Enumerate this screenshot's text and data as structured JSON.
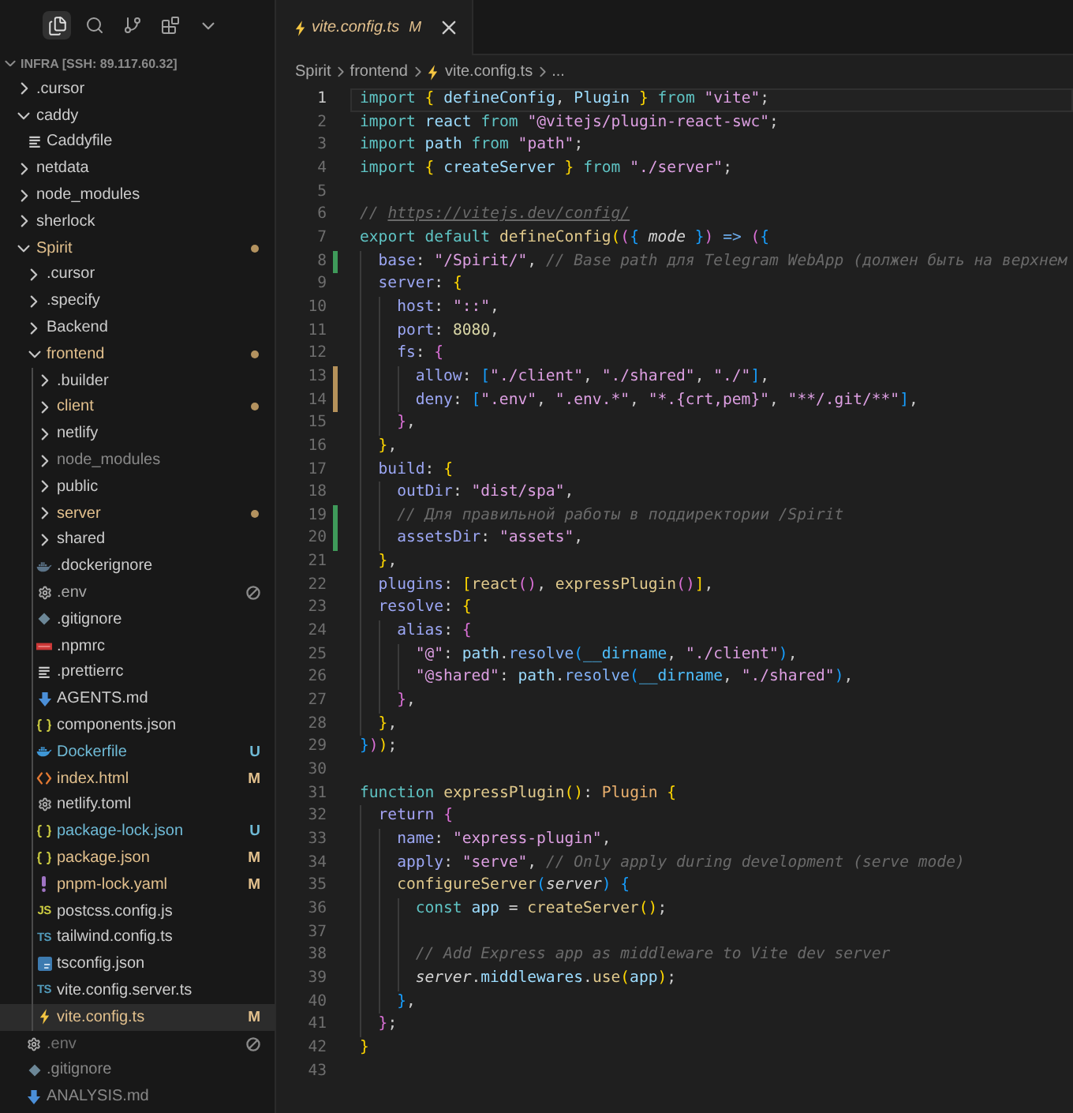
{
  "sidebar": {
    "toolbar": [
      {
        "kind": "explorer",
        "selected": true
      },
      {
        "kind": "search",
        "selected": false
      },
      {
        "kind": "source-control",
        "selected": false
      },
      {
        "kind": "extensions",
        "selected": false
      },
      {
        "kind": "more",
        "selected": false
      }
    ],
    "root": {
      "label": "INFRA [SSH: 89.117.60.32]",
      "expanded": true
    },
    "items": [
      {
        "name": ".cursor",
        "kind": "folder",
        "expanded": false,
        "selected": false,
        "modified": false,
        "untracked": false,
        "ignored": false,
        "excluded": false
      },
      {
        "name": "caddy",
        "kind": "folder",
        "expanded": true,
        "selected": false,
        "modified": false,
        "untracked": false,
        "ignored": false,
        "excluded": false,
        "children": [
          {
            "name": "Caddyfile",
            "kind": "text",
            "selected": false,
            "modified": false,
            "untracked": false,
            "ignored": false,
            "excluded": false
          }
        ]
      },
      {
        "name": "netdata",
        "kind": "folder",
        "expanded": false,
        "selected": false,
        "modified": false,
        "untracked": false,
        "ignored": false,
        "excluded": false
      },
      {
        "name": "node_modules",
        "kind": "folder",
        "expanded": false,
        "selected": false,
        "modified": false,
        "untracked": false,
        "ignored": false,
        "excluded": false
      },
      {
        "name": "sherlock",
        "kind": "folder",
        "expanded": false,
        "selected": false,
        "modified": false,
        "untracked": false,
        "ignored": false,
        "excluded": false
      },
      {
        "name": "Spirit",
        "kind": "folder",
        "expanded": true,
        "selected": false,
        "modified": true,
        "untracked": false,
        "ignored": false,
        "excluded": false,
        "children": [
          {
            "name": ".cursor",
            "kind": "folder",
            "expanded": false,
            "selected": false,
            "modified": false,
            "untracked": false,
            "ignored": false,
            "excluded": false
          },
          {
            "name": ".specify",
            "kind": "folder",
            "expanded": false,
            "selected": false,
            "modified": false,
            "untracked": false,
            "ignored": false,
            "excluded": false
          },
          {
            "name": "Backend",
            "kind": "folder",
            "expanded": false,
            "selected": false,
            "modified": false,
            "untracked": false,
            "ignored": false,
            "excluded": false
          },
          {
            "name": "frontend",
            "kind": "folder",
            "expanded": true,
            "selected": false,
            "modified": true,
            "untracked": false,
            "ignored": false,
            "excluded": false,
            "children": [
              {
                "name": ".builder",
                "kind": "folder",
                "expanded": false,
                "selected": false,
                "modified": false,
                "untracked": false,
                "ignored": false,
                "excluded": false
              },
              {
                "name": "client",
                "kind": "folder",
                "expanded": false,
                "selected": false,
                "modified": true,
                "untracked": false,
                "ignored": false,
                "excluded": false
              },
              {
                "name": "netlify",
                "kind": "folder",
                "expanded": false,
                "selected": false,
                "modified": false,
                "untracked": false,
                "ignored": false,
                "excluded": false
              },
              {
                "name": "node_modules",
                "kind": "folder",
                "expanded": false,
                "selected": false,
                "modified": false,
                "untracked": false,
                "ignored": true,
                "excluded": false
              },
              {
                "name": "public",
                "kind": "folder",
                "expanded": false,
                "selected": false,
                "modified": false,
                "untracked": false,
                "ignored": false,
                "excluded": false
              },
              {
                "name": "server",
                "kind": "folder",
                "expanded": false,
                "selected": false,
                "modified": true,
                "untracked": false,
                "ignored": false,
                "excluded": false
              },
              {
                "name": "shared",
                "kind": "folder",
                "expanded": false,
                "selected": false,
                "modified": false,
                "untracked": false,
                "ignored": false,
                "excluded": false
              },
              {
                "name": ".dockerignore",
                "kind": "dockerignore",
                "selected": false,
                "modified": false,
                "untracked": false,
                "ignored": false,
                "excluded": false
              },
              {
                "name": ".env",
                "kind": "settings",
                "selected": false,
                "modified": false,
                "untracked": false,
                "ignored": false,
                "excluded": true
              },
              {
                "name": ".gitignore",
                "kind": "git",
                "selected": false,
                "modified": false,
                "untracked": false,
                "ignored": false,
                "excluded": false
              },
              {
                "name": ".npmrc",
                "kind": "npm",
                "selected": false,
                "modified": false,
                "untracked": false,
                "ignored": false,
                "excluded": false
              },
              {
                "name": ".prettierrc",
                "kind": "text",
                "selected": false,
                "modified": false,
                "untracked": false,
                "ignored": false,
                "excluded": false
              },
              {
                "name": "AGENTS.md",
                "kind": "markdown",
                "selected": false,
                "modified": false,
                "untracked": false,
                "ignored": false,
                "excluded": false
              },
              {
                "name": "components.json",
                "kind": "json",
                "selected": false,
                "modified": false,
                "untracked": false,
                "ignored": false,
                "excluded": false
              },
              {
                "name": "Dockerfile",
                "kind": "docker",
                "selected": false,
                "modified": false,
                "untracked": true,
                "ignored": false,
                "excluded": false,
                "badge": "U"
              },
              {
                "name": "index.html",
                "kind": "html",
                "selected": false,
                "modified": true,
                "untracked": false,
                "ignored": false,
                "excluded": false,
                "badge": "M"
              },
              {
                "name": "netlify.toml",
                "kind": "settings",
                "selected": false,
                "modified": false,
                "untracked": false,
                "ignored": false,
                "excluded": false
              },
              {
                "name": "package-lock.json",
                "kind": "json",
                "selected": false,
                "modified": false,
                "untracked": true,
                "ignored": false,
                "excluded": false,
                "badge": "U"
              },
              {
                "name": "package.json",
                "kind": "json",
                "selected": false,
                "modified": true,
                "untracked": false,
                "ignored": false,
                "excluded": false,
                "badge": "M"
              },
              {
                "name": "pnpm-lock.yaml",
                "kind": "yaml",
                "selected": false,
                "modified": true,
                "untracked": false,
                "ignored": false,
                "excluded": false,
                "badge": "M"
              },
              {
                "name": "postcss.config.js",
                "kind": "js",
                "icon_label": "JS",
                "selected": false,
                "modified": false,
                "untracked": false,
                "ignored": false,
                "excluded": false
              },
              {
                "name": "tailwind.config.ts",
                "kind": "ts",
                "icon_label": "TS",
                "selected": false,
                "modified": false,
                "untracked": false,
                "ignored": false,
                "excluded": false
              },
              {
                "name": "tsconfig.json",
                "kind": "tsconfig",
                "selected": false,
                "modified": false,
                "untracked": false,
                "ignored": false,
                "excluded": false
              },
              {
                "name": "vite.config.server.ts",
                "kind": "ts",
                "icon_label": "TS",
                "selected": false,
                "modified": false,
                "untracked": false,
                "ignored": false,
                "excluded": false
              },
              {
                "name": "vite.config.ts",
                "kind": "vite",
                "selected": true,
                "modified": true,
                "untracked": false,
                "ignored": false,
                "excluded": false,
                "badge": "M"
              }
            ]
          },
          {
            "name": ".env",
            "kind": "settings",
            "selected": false,
            "modified": false,
            "untracked": false,
            "ignored": true,
            "excluded": true
          },
          {
            "name": ".gitignore",
            "kind": "git",
            "selected": false,
            "modified": false,
            "untracked": false,
            "ignored": true,
            "excluded": false
          },
          {
            "name": "ANALYSIS.md",
            "kind": "markdown",
            "selected": false,
            "modified": false,
            "untracked": false,
            "ignored": true,
            "excluded": false
          }
        ]
      }
    ]
  },
  "editor": {
    "tabs": [
      {
        "label": "vite.config.ts",
        "kind": "vite",
        "badge": "M",
        "modified": true,
        "preview": true,
        "selected": true
      }
    ],
    "breadcrumbs": [
      {
        "label": "Spirit",
        "kind": "folder"
      },
      {
        "label": "frontend",
        "kind": "folder"
      },
      {
        "label": "vite.config.ts",
        "kind": "vite"
      },
      {
        "label": "...",
        "kind": "more"
      }
    ],
    "lines": [
      {
        "number": "1",
        "current": true,
        "tokens": [
          {
            "kind": "keyword",
            "text": "import "
          },
          {
            "kind": "bracket1",
            "text": "{ "
          },
          {
            "kind": "variable",
            "text": "defineConfig"
          },
          {
            "kind": "punct",
            "text": ", "
          },
          {
            "kind": "variable",
            "text": "Plugin "
          },
          {
            "kind": "bracket1",
            "text": "} "
          },
          {
            "kind": "keyword",
            "text": "from "
          },
          {
            "kind": "string",
            "text": "\"vite\""
          },
          {
            "kind": "punct",
            "text": ";"
          }
        ]
      },
      {
        "number": "2",
        "current": false,
        "tokens": [
          {
            "kind": "keyword",
            "text": "import "
          },
          {
            "kind": "variable",
            "text": "react "
          },
          {
            "kind": "keyword",
            "text": "from "
          },
          {
            "kind": "string",
            "text": "\"@vitejs/plugin-react-swc\""
          },
          {
            "kind": "punct",
            "text": ";"
          }
        ]
      },
      {
        "number": "3",
        "current": false,
        "tokens": [
          {
            "kind": "keyword",
            "text": "import "
          },
          {
            "kind": "variable",
            "text": "path "
          },
          {
            "kind": "keyword",
            "text": "from "
          },
          {
            "kind": "string",
            "text": "\"path\""
          },
          {
            "kind": "punct",
            "text": ";"
          }
        ]
      },
      {
        "number": "4",
        "current": false,
        "tokens": [
          {
            "kind": "keyword",
            "text": "import "
          },
          {
            "kind": "bracket1",
            "text": "{ "
          },
          {
            "kind": "variable",
            "text": "createServer "
          },
          {
            "kind": "bracket1",
            "text": "} "
          },
          {
            "kind": "keyword",
            "text": "from "
          },
          {
            "kind": "string",
            "text": "\"./server\""
          },
          {
            "kind": "punct",
            "text": ";"
          }
        ]
      },
      {
        "number": "5",
        "current": false
      },
      {
        "number": "6",
        "current": false,
        "tokens": [
          {
            "kind": "comment",
            "text": "// "
          },
          {
            "kind": "link",
            "text": "https://vitejs.dev/config/"
          }
        ]
      },
      {
        "number": "7",
        "current": false,
        "tokens": [
          {
            "kind": "keyword",
            "text": "export default "
          },
          {
            "kind": "function",
            "text": "defineConfig"
          },
          {
            "kind": "bracket1",
            "text": "("
          },
          {
            "kind": "bracket2",
            "text": "("
          },
          {
            "kind": "bracket3",
            "text": "{ "
          },
          {
            "kind": "param",
            "text": "mode"
          },
          {
            "kind": "bracket3",
            "text": " }"
          },
          {
            "kind": "bracket2",
            "text": ")"
          },
          {
            "kind": "operator",
            "text": " => "
          },
          {
            "kind": "bracket2",
            "text": "("
          },
          {
            "kind": "bracket3",
            "text": "{"
          }
        ],
        "children": [
          {
            "number": "8",
            "kind": "added",
            "current": false,
            "tokens": [
              {
                "kind": "property",
                "text": "base"
              },
              {
                "kind": "punct",
                "text": ": "
              },
              {
                "kind": "string",
                "text": "\"/Spirit/\""
              },
              {
                "kind": "punct",
                "text": ", "
              },
              {
                "kind": "comment",
                "text": "// Base path для Telegram WebApp (должен быть на верхнем"
              }
            ]
          },
          {
            "number": "9",
            "current": false,
            "tokens": [
              {
                "kind": "property",
                "text": "server"
              },
              {
                "kind": "punct",
                "text": ": "
              },
              {
                "kind": "bracket1",
                "text": "{"
              }
            ],
            "children": [
              {
                "number": "10",
                "current": false,
                "tokens": [
                  {
                    "kind": "property",
                    "text": "host"
                  },
                  {
                    "kind": "punct",
                    "text": ": "
                  },
                  {
                    "kind": "string",
                    "text": "\"::\""
                  },
                  {
                    "kind": "punct",
                    "text": ","
                  }
                ]
              },
              {
                "number": "11",
                "current": false,
                "tokens": [
                  {
                    "kind": "property",
                    "text": "port"
                  },
                  {
                    "kind": "punct",
                    "text": ": "
                  },
                  {
                    "kind": "number",
                    "text": "8080"
                  },
                  {
                    "kind": "punct",
                    "text": ","
                  }
                ]
              },
              {
                "number": "12",
                "current": false,
                "tokens": [
                  {
                    "kind": "property",
                    "text": "fs"
                  },
                  {
                    "kind": "punct",
                    "text": ": "
                  },
                  {
                    "kind": "bracket2",
                    "text": "{"
                  }
                ],
                "children": [
                  {
                    "number": "13",
                    "kind": "modified",
                    "current": false,
                    "tokens": [
                      {
                        "kind": "property",
                        "text": "allow"
                      },
                      {
                        "kind": "punct",
                        "text": ": "
                      },
                      {
                        "kind": "bracket3",
                        "text": "["
                      },
                      {
                        "kind": "string",
                        "text": "\"./client\""
                      },
                      {
                        "kind": "punct",
                        "text": ", "
                      },
                      {
                        "kind": "string",
                        "text": "\"./shared\""
                      },
                      {
                        "kind": "punct",
                        "text": ", "
                      },
                      {
                        "kind": "string",
                        "text": "\"./\""
                      },
                      {
                        "kind": "bracket3",
                        "text": "]"
                      },
                      {
                        "kind": "punct",
                        "text": ","
                      }
                    ]
                  },
                  {
                    "number": "14",
                    "kind": "modified",
                    "current": false,
                    "tokens": [
                      {
                        "kind": "property",
                        "text": "deny"
                      },
                      {
                        "kind": "punct",
                        "text": ": "
                      },
                      {
                        "kind": "bracket3",
                        "text": "["
                      },
                      {
                        "kind": "string",
                        "text": "\".env\""
                      },
                      {
                        "kind": "punct",
                        "text": ", "
                      },
                      {
                        "kind": "string",
                        "text": "\".env.*\""
                      },
                      {
                        "kind": "punct",
                        "text": ", "
                      },
                      {
                        "kind": "string",
                        "text": "\"*.{crt,pem}\""
                      },
                      {
                        "kind": "punct",
                        "text": ", "
                      },
                      {
                        "kind": "string",
                        "text": "\"**/.git/**\""
                      },
                      {
                        "kind": "bracket3",
                        "text": "]"
                      },
                      {
                        "kind": "punct",
                        "text": ","
                      }
                    ]
                  }
                ]
              },
              {
                "number": "15",
                "current": false,
                "tokens": [
                  {
                    "kind": "bracket2",
                    "text": "}"
                  },
                  {
                    "kind": "punct",
                    "text": ","
                  }
                ]
              }
            ]
          },
          {
            "number": "16",
            "current": false,
            "tokens": [
              {
                "kind": "bracket1",
                "text": "}"
              },
              {
                "kind": "punct",
                "text": ","
              }
            ]
          },
          {
            "number": "17",
            "current": false,
            "tokens": [
              {
                "kind": "property",
                "text": "build"
              },
              {
                "kind": "punct",
                "text": ": "
              },
              {
                "kind": "bracket1",
                "text": "{"
              }
            ],
            "children": [
              {
                "number": "18",
                "current": false,
                "tokens": [
                  {
                    "kind": "property",
                    "text": "outDir"
                  },
                  {
                    "kind": "punct",
                    "text": ": "
                  },
                  {
                    "kind": "string",
                    "text": "\"dist/spa\""
                  },
                  {
                    "kind": "punct",
                    "text": ","
                  }
                ]
              },
              {
                "number": "19",
                "kind": "added",
                "current": false,
                "tokens": [
                  {
                    "kind": "comment",
                    "text": "// Для правильной работы в поддиректории /Spirit"
                  }
                ]
              },
              {
                "number": "20",
                "kind": "added",
                "current": false,
                "tokens": [
                  {
                    "kind": "property",
                    "text": "assetsDir"
                  },
                  {
                    "kind": "punct",
                    "text": ": "
                  },
                  {
                    "kind": "string",
                    "text": "\"assets\""
                  },
                  {
                    "kind": "punct",
                    "text": ","
                  }
                ]
              }
            ]
          },
          {
            "number": "21",
            "current": false,
            "tokens": [
              {
                "kind": "bracket1",
                "text": "}"
              },
              {
                "kind": "punct",
                "text": ","
              }
            ]
          },
          {
            "number": "22",
            "current": false,
            "tokens": [
              {
                "kind": "property",
                "text": "plugins"
              },
              {
                "kind": "punct",
                "text": ": "
              },
              {
                "kind": "bracket1",
                "text": "["
              },
              {
                "kind": "function",
                "text": "react"
              },
              {
                "kind": "bracket2",
                "text": "()"
              },
              {
                "kind": "punct",
                "text": ", "
              },
              {
                "kind": "function",
                "text": "expressPlugin"
              },
              {
                "kind": "bracket2",
                "text": "()"
              },
              {
                "kind": "bracket1",
                "text": "]"
              },
              {
                "kind": "punct",
                "text": ","
              }
            ]
          },
          {
            "number": "23",
            "current": false,
            "tokens": [
              {
                "kind": "property",
                "text": "resolve"
              },
              {
                "kind": "punct",
                "text": ": "
              },
              {
                "kind": "bracket1",
                "text": "{"
              }
            ],
            "children": [
              {
                "number": "24",
                "current": false,
                "tokens": [
                  {
                    "kind": "property",
                    "text": "alias"
                  },
                  {
                    "kind": "punct",
                    "text": ": "
                  },
                  {
                    "kind": "bracket2",
                    "text": "{"
                  }
                ],
                "children": [
                  {
                    "number": "25",
                    "current": false,
                    "tokens": [
                      {
                        "kind": "string",
                        "text": "\"@\""
                      },
                      {
                        "kind": "punct",
                        "text": ": "
                      },
                      {
                        "kind": "variable",
                        "text": "path"
                      },
                      {
                        "kind": "punct",
                        "text": "."
                      },
                      {
                        "kind": "method",
                        "text": "resolve"
                      },
                      {
                        "kind": "bracket3",
                        "text": "("
                      },
                      {
                        "kind": "builtin",
                        "text": "__dirname"
                      },
                      {
                        "kind": "punct",
                        "text": ", "
                      },
                      {
                        "kind": "string",
                        "text": "\"./client\""
                      },
                      {
                        "kind": "bracket3",
                        "text": ")"
                      },
                      {
                        "kind": "punct",
                        "text": ","
                      }
                    ]
                  },
                  {
                    "number": "26",
                    "current": false,
                    "tokens": [
                      {
                        "kind": "string",
                        "text": "\"@shared\""
                      },
                      {
                        "kind": "punct",
                        "text": ": "
                      },
                      {
                        "kind": "variable",
                        "text": "path"
                      },
                      {
                        "kind": "punct",
                        "text": "."
                      },
                      {
                        "kind": "method",
                        "text": "resolve"
                      },
                      {
                        "kind": "bracket3",
                        "text": "("
                      },
                      {
                        "kind": "builtin",
                        "text": "__dirname"
                      },
                      {
                        "kind": "punct",
                        "text": ", "
                      },
                      {
                        "kind": "string",
                        "text": "\"./shared\""
                      },
                      {
                        "kind": "bracket3",
                        "text": ")"
                      },
                      {
                        "kind": "punct",
                        "text": ","
                      }
                    ]
                  }
                ]
              },
              {
                "number": "27",
                "current": false,
                "tokens": [
                  {
                    "kind": "bracket2",
                    "text": "}"
                  },
                  {
                    "kind": "punct",
                    "text": ","
                  }
                ]
              }
            ]
          },
          {
            "number": "28",
            "current": false,
            "tokens": [
              {
                "kind": "bracket1",
                "text": "}"
              },
              {
                "kind": "punct",
                "text": ","
              }
            ]
          }
        ]
      },
      {
        "number": "29",
        "current": false,
        "tokens": [
          {
            "kind": "bracket3",
            "text": "}"
          },
          {
            "kind": "bracket2",
            "text": ")"
          },
          {
            "kind": "bracket1",
            "text": ")"
          },
          {
            "kind": "punct",
            "text": ";"
          }
        ]
      },
      {
        "number": "30",
        "current": false
      },
      {
        "number": "31",
        "current": false,
        "tokens": [
          {
            "kind": "keyword",
            "text": "function "
          },
          {
            "kind": "function",
            "text": "expressPlugin"
          },
          {
            "kind": "bracket1",
            "text": "()"
          },
          {
            "kind": "punct",
            "text": ": "
          },
          {
            "kind": "type",
            "text": "Plugin "
          },
          {
            "kind": "bracket1",
            "text": "{"
          }
        ],
        "children": [
          {
            "number": "32",
            "current": false,
            "tokens": [
              {
                "kind": "control",
                "text": "return "
              },
              {
                "kind": "bracket2",
                "text": "{"
              }
            ],
            "children": [
              {
                "number": "33",
                "current": false,
                "tokens": [
                  {
                    "kind": "property",
                    "text": "name"
                  },
                  {
                    "kind": "punct",
                    "text": ": "
                  },
                  {
                    "kind": "string",
                    "text": "\"express-plugin\""
                  },
                  {
                    "kind": "punct",
                    "text": ","
                  }
                ]
              },
              {
                "number": "34",
                "current": false,
                "tokens": [
                  {
                    "kind": "property",
                    "text": "apply"
                  },
                  {
                    "kind": "punct",
                    "text": ": "
                  },
                  {
                    "kind": "string",
                    "text": "\"serve\""
                  },
                  {
                    "kind": "punct",
                    "text": ", "
                  },
                  {
                    "kind": "comment",
                    "text": "// Only apply during development (serve mode)"
                  }
                ]
              },
              {
                "number": "35",
                "current": false,
                "tokens": [
                  {
                    "kind": "function",
                    "text": "configureServer"
                  },
                  {
                    "kind": "bracket3",
                    "text": "("
                  },
                  {
                    "kind": "param",
                    "text": "server"
                  },
                  {
                    "kind": "bracket3",
                    "text": ") "
                  },
                  {
                    "kind": "bracket3",
                    "text": "{"
                  }
                ],
                "children": [
                  {
                    "number": "36",
                    "current": false,
                    "tokens": [
                      {
                        "kind": "keyword",
                        "text": "const "
                      },
                      {
                        "kind": "variable",
                        "text": "app "
                      },
                      {
                        "kind": "punct",
                        "text": "= "
                      },
                      {
                        "kind": "function",
                        "text": "createServer"
                      },
                      {
                        "kind": "bracket1",
                        "text": "()"
                      },
                      {
                        "kind": "punct",
                        "text": ";"
                      }
                    ]
                  },
                  {
                    "number": "37",
                    "current": false
                  },
                  {
                    "number": "38",
                    "current": false,
                    "tokens": [
                      {
                        "kind": "comment",
                        "text": "// Add Express app as middleware to Vite dev server"
                      }
                    ]
                  },
                  {
                    "number": "39",
                    "current": false,
                    "tokens": [
                      {
                        "kind": "param",
                        "text": "server"
                      },
                      {
                        "kind": "punct",
                        "text": "."
                      },
                      {
                        "kind": "variable",
                        "text": "middlewares"
                      },
                      {
                        "kind": "punct",
                        "text": "."
                      },
                      {
                        "kind": "function",
                        "text": "use"
                      },
                      {
                        "kind": "bracket1",
                        "text": "("
                      },
                      {
                        "kind": "variable",
                        "text": "app"
                      },
                      {
                        "kind": "bracket1",
                        "text": ")"
                      },
                      {
                        "kind": "punct",
                        "text": ";"
                      }
                    ]
                  }
                ]
              },
              {
                "number": "40",
                "current": false,
                "tokens": [
                  {
                    "kind": "bracket3",
                    "text": "}"
                  },
                  {
                    "kind": "punct",
                    "text": ","
                  }
                ]
              }
            ]
          },
          {
            "number": "41",
            "current": false,
            "tokens": [
              {
                "kind": "bracket2",
                "text": "}"
              },
              {
                "kind": "punct",
                "text": ";"
              }
            ]
          }
        ]
      },
      {
        "number": "42",
        "current": false,
        "tokens": [
          {
            "kind": "bracket1",
            "text": "}"
          }
        ]
      },
      {
        "number": "43",
        "current": false
      }
    ]
  }
}
